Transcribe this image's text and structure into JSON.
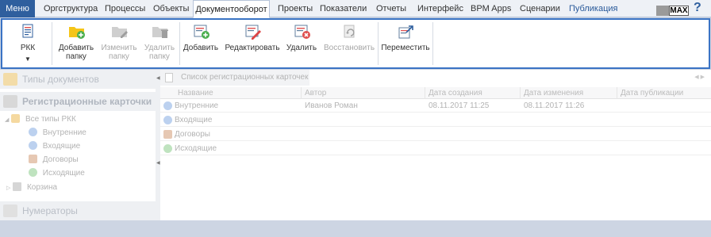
{
  "menu": {
    "items": [
      {
        "label": "Меню"
      },
      {
        "label": "Оргструктура"
      },
      {
        "label": "Процессы"
      },
      {
        "label": "Объекты"
      },
      {
        "label": "Документооборот"
      },
      {
        "label": "Проекты"
      },
      {
        "label": "Показатели"
      },
      {
        "label": "Отчеты"
      },
      {
        "label": "Интерфейс"
      },
      {
        "label": "BPM Apps"
      },
      {
        "label": "Сценарии"
      },
      {
        "label": "Публикация"
      }
    ],
    "active": "Документооборот",
    "badge": "MAX",
    "help": "?"
  },
  "ribbon": {
    "rkk": {
      "label": "РКК"
    },
    "add_folder": {
      "label1": "Добавить",
      "label2": "папку"
    },
    "edit_folder": {
      "label1": "Изменить",
      "label2": "папку"
    },
    "delete_folder": {
      "label1": "Удалить",
      "label2": "папку"
    },
    "add": {
      "label": "Добавить"
    },
    "edit": {
      "label": "Редактировать"
    },
    "delete": {
      "label": "Удалить"
    },
    "restore": {
      "label": "Восстановить"
    },
    "move": {
      "label": "Переместить"
    }
  },
  "sidebar": {
    "doc_types": "Типы документов",
    "reg_cards": "Регистрационные карточки",
    "tree": {
      "all": "Все типы РКК",
      "children": [
        "Внутренние",
        "Входящие",
        "Договоры",
        "Исходящие"
      ],
      "trash": "Корзина"
    },
    "numerators": "Нумераторы"
  },
  "main": {
    "tab": "Список регистрационных карточек",
    "columns": [
      "Название",
      "Автор",
      "Дата создания",
      "Дата изменения",
      "Дата публикации"
    ],
    "rows": [
      {
        "name": "Внутренние",
        "author": "Иванов Роман",
        "created": "08.11.2017 11:25",
        "modified": "08.11.2017 11:26",
        "published": ""
      },
      {
        "name": "Входящие",
        "author": "",
        "created": "",
        "modified": "",
        "published": ""
      },
      {
        "name": "Договоры",
        "author": "",
        "created": "",
        "modified": "",
        "published": ""
      },
      {
        "name": "Исходящие",
        "author": "",
        "created": "",
        "modified": "",
        "published": ""
      }
    ]
  },
  "colors": {
    "accent": "#2f5f9e",
    "ribbon_border": "#3a73c4",
    "folder": "#f5c518",
    "green": "#4caf50",
    "red": "#e05050"
  }
}
